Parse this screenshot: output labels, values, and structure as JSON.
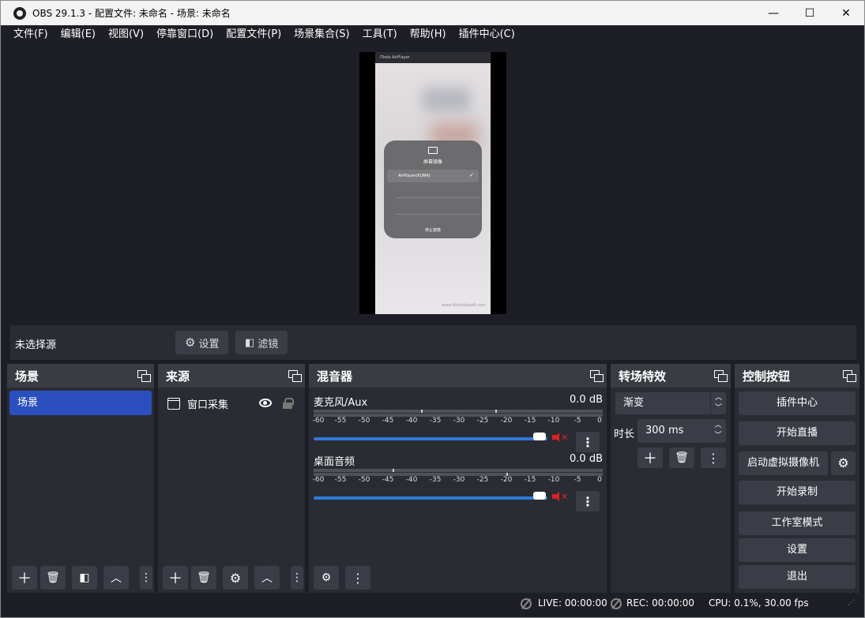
{
  "window": {
    "title": "OBS 29.1.3 - 配置文件: 未命名 - 场景: 未命名",
    "minimize": "—",
    "maximize": "☐",
    "close": "✕"
  },
  "menu": [
    "文件(F)",
    "编辑(E)",
    "视图(V)",
    "停靠窗口(D)",
    "配置文件(P)",
    "场景集合(S)",
    "工具(T)",
    "帮助(H)",
    "插件中心(C)"
  ],
  "preview": {
    "phone_title": "iTools AirPlayer",
    "panel_title": "屏幕镜像",
    "device": "AirPlayer(KUMA)",
    "stop": "停止镜像",
    "watermark": "www.thinkskysoft.com"
  },
  "sourcebar": {
    "no_selection": "未选择源",
    "settings": "设置",
    "filters": "滤镜"
  },
  "scenes": {
    "title": "场景",
    "items": [
      "场景"
    ]
  },
  "sources": {
    "title": "来源",
    "items": [
      "窗口采集"
    ]
  },
  "mixer": {
    "title": "混音器",
    "channels": [
      {
        "name": "麦克风/Aux",
        "db": "0.0 dB",
        "muted": true,
        "volume": 1.0
      },
      {
        "name": "桌面音频",
        "db": "0.0 dB",
        "muted": true,
        "volume": 1.0
      }
    ],
    "ticks": [
      "-60",
      "-55",
      "-50",
      "-45",
      "-40",
      "-35",
      "-30",
      "-25",
      "-20",
      "-15",
      "-10",
      "-5",
      "0"
    ]
  },
  "transitions": {
    "title": "转场特效",
    "selected": "渐变",
    "duration_label": "时长",
    "duration": "300 ms"
  },
  "controls": {
    "title": "控制按钮",
    "plugin_center": "插件中心",
    "start_stream": "开始直播",
    "virtual_cam": "启动虚拟摄像机",
    "start_record": "开始录制",
    "studio_mode": "工作室模式",
    "settings": "设置",
    "exit": "退出"
  },
  "status": {
    "live": "LIVE: 00:00:00",
    "rec": "REC: 00:00:00",
    "cpu": "CPU: 0.1%, 30.00 fps"
  },
  "colors": {
    "accent": "#2b4fbf",
    "slider": "#2e7cd8",
    "mute": "#dd2222"
  }
}
